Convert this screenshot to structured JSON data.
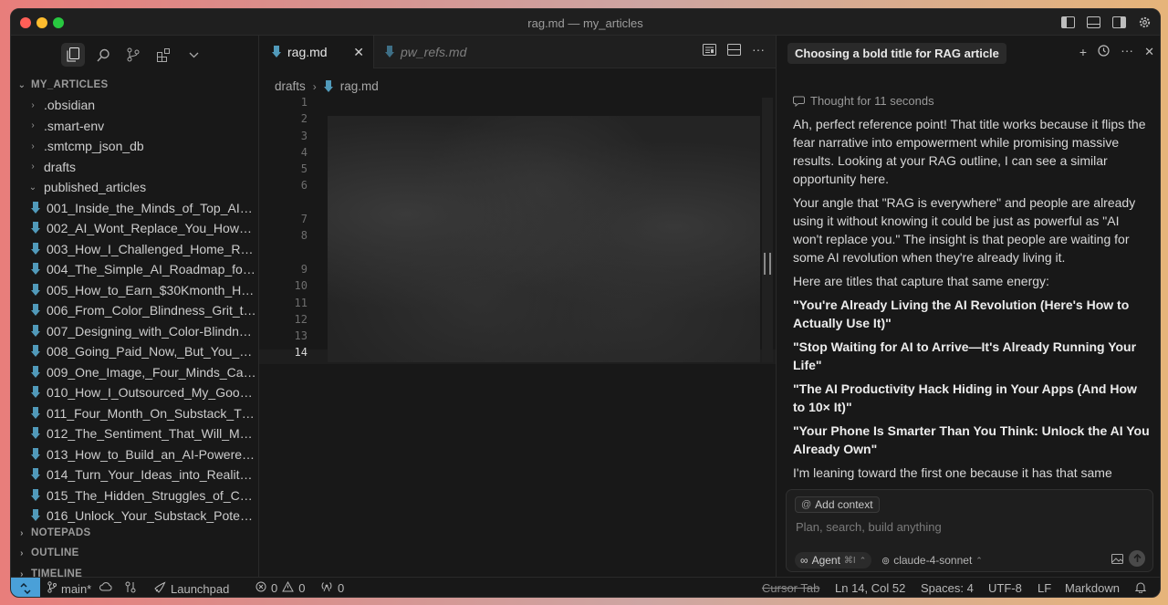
{
  "window": {
    "title": "rag.md — my_articles"
  },
  "sidebar": {
    "workspace": "MY_ARTICLES",
    "folders": [
      {
        "label": ".obsidian",
        "open": false
      },
      {
        "label": ".smart-env",
        "open": false
      },
      {
        "label": ".smtcmp_json_db",
        "open": false
      },
      {
        "label": "drafts",
        "open": false
      },
      {
        "label": "published_articles",
        "open": true
      }
    ],
    "files": [
      "001_Inside_the_Minds_of_Top_AI_...",
      "002_AI_Wont_Replace_You_How_t...",
      "003_How_I_Challenged_Home_Re...",
      "004_The_Simple_AI_Roadmap_for...",
      "005_How_to_Earn_$30Kmonth_Hu...",
      "006_From_Color_Blindness_Grit_to...",
      "007_Designing_with_Color-Blindne...",
      "008_Going_Paid_Now,_But_You_C...",
      "009_One_Image,_Four_Minds_Can...",
      "010_How_I_Outsourced_My_Googl...",
      "011_Four_Month_On_Substack_Th...",
      "012_The_Sentiment_That_Will_Mak...",
      "013_How_to_Build_an_AI-Powered...",
      "014_Turn_Your_Ideas_into_Reality_...",
      "015_The_Hidden_Struggles_of_Ch...",
      "016_Unlock_Your_Substack_Potent..."
    ],
    "sections": {
      "notepads": "NOTEPADS",
      "outline": "OUTLINE",
      "timeline": "TIMELINE"
    }
  },
  "editor": {
    "active_tab": "rag.md",
    "inactive_tab": "pw_refs.md",
    "breadcrumb": {
      "folder": "drafts",
      "file": "rag.md"
    },
    "line_numbers": [
      "1",
      "2",
      "3",
      "4",
      "5",
      "6",
      "",
      "7",
      "8",
      "",
      "9",
      "10",
      "11",
      "12",
      "13",
      "14"
    ],
    "active_line": "14"
  },
  "chat": {
    "title": "Choosing a bold title for RAG article",
    "thought": "Thought for 11 seconds",
    "messages": [
      {
        "bold": false,
        "text": "Ah, perfect reference point! That title works because it flips the fear narrative into empowerment while promising massive results. Looking at your RAG outline, I can see a similar opportunity here."
      },
      {
        "bold": false,
        "text": "Your angle that \"RAG is everywhere\" and people are already using it without knowing it could be just as powerful as \"AI won't replace you.\" The insight is that people are waiting for some AI revolution when they're already living it."
      },
      {
        "bold": false,
        "text": "Here are titles that capture that same energy:"
      },
      {
        "bold": true,
        "text": "\"You're Already Living the AI Revolution (Here's How to Actually Use It)\""
      },
      {
        "bold": true,
        "text": "\"Stop Waiting for AI to Arrive—It's Already Running Your Life\""
      },
      {
        "bold": true,
        "text": "\"The AI Productivity Hack Hiding in Your Apps (And How to 10× It)\""
      },
      {
        "bold": true,
        "text": "\"Your Phone Is Smarter Than You Think: Unlock the AI You Already Own\""
      },
      {
        "bold": false,
        "text": "I'm leaning toward the first one because it has that same"
      }
    ],
    "composer": {
      "add_context": "Add context",
      "placeholder": "Plan, search, build anything",
      "agent_label": "Agent",
      "agent_shortcut": "⌘I",
      "model": "claude-4-sonnet"
    }
  },
  "statusbar": {
    "branch": "main*",
    "launchpad": "Launchpad",
    "errors": "0",
    "warnings": "0",
    "ports": "0",
    "cursor_tab": "Cursor Tab",
    "position": "Ln 14, Col 52",
    "spaces": "Spaces: 4",
    "encoding": "UTF-8",
    "eol": "LF",
    "language": "Markdown"
  },
  "colors": {
    "accent": "#4aa0d8",
    "markdown_icon": "#519aba",
    "background": "#181818"
  }
}
